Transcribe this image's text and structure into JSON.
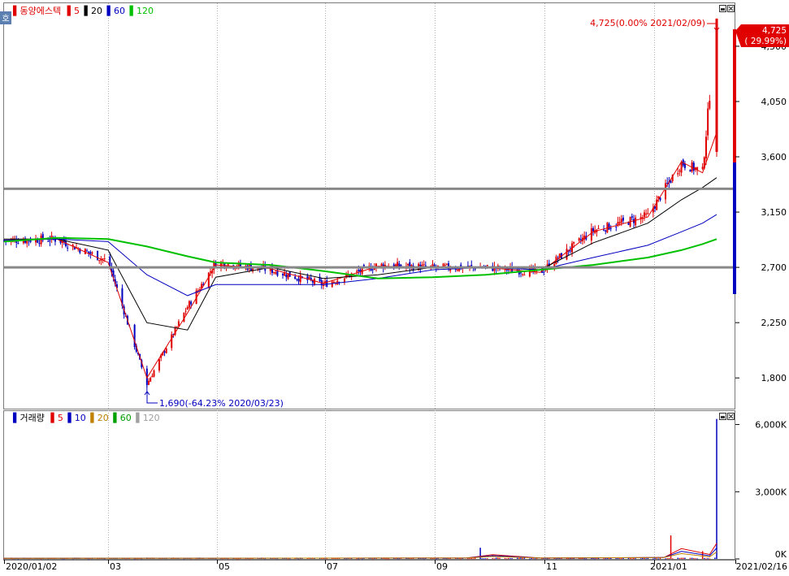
{
  "price_panel": {
    "legend_prefix": "▌",
    "name": "동양에스텍",
    "ma_labels": [
      {
        "text": "5",
        "color": "#e00000"
      },
      {
        "text": "20",
        "color": "#000000"
      },
      {
        "text": "60",
        "color": "#0000c0"
      },
      {
        "text": "120",
        "color": "#00c000"
      }
    ],
    "corner_tag": "호",
    "current_price_label": "4,725",
    "current_change_label": "( 29.99%)",
    "high_annotation": "4,725(0.00% 2021/02/09)",
    "low_annotation": "1,690(-64.23% 2020/03/23)"
  },
  "volume_panel": {
    "legend_prefix": "▌",
    "name": "거래량",
    "ma_labels": [
      {
        "text": "5",
        "color": "#e00000"
      },
      {
        "text": "10",
        "color": "#0000c0"
      },
      {
        "text": "20",
        "color": "#c08000"
      },
      {
        "text": "60",
        "color": "#00a000"
      },
      {
        "text": "120",
        "color": "#a0a0a0"
      }
    ]
  },
  "x_axis": {
    "labels": [
      "2020/01/02",
      "03",
      "05",
      "07",
      "09",
      "11",
      "2021/01",
      "2021/02/16"
    ]
  },
  "chart_data": [
    {
      "type": "candlestick",
      "title": "동양에스텍",
      "x": [
        "2020-01-02",
        "2020-02-01",
        "2020-03-01",
        "2020-03-23",
        "2020-04-15",
        "2020-05-01",
        "2020-06-01",
        "2020-07-01",
        "2020-08-01",
        "2020-09-01",
        "2020-10-01",
        "2020-11-01",
        "2020-12-01",
        "2021-01-01",
        "2021-01-20",
        "2021-02-01",
        "2021-02-09"
      ],
      "close": [
        2920,
        2930,
        2750,
        1750,
        2380,
        2740,
        2680,
        2560,
        2720,
        2700,
        2700,
        2660,
        3000,
        3120,
        3550,
        3480,
        4725
      ],
      "y_ticks": [
        1800,
        2250,
        2700,
        3150,
        3600,
        4050,
        4500
      ],
      "ylim": [
        1550,
        4850
      ],
      "high": 4725,
      "low": 1690,
      "support_lines": [
        3340,
        2700
      ],
      "series": [
        {
          "name": "5",
          "color": "#e00000",
          "values": [
            2920,
            2930,
            2740,
            1800,
            2330,
            2720,
            2690,
            2570,
            2710,
            2700,
            2700,
            2660,
            2990,
            3110,
            3560,
            3470,
            3800
          ]
        },
        {
          "name": "20",
          "color": "#000000",
          "values": [
            2930,
            2930,
            2840,
            2250,
            2190,
            2620,
            2700,
            2610,
            2640,
            2700,
            2700,
            2680,
            2900,
            3060,
            3250,
            3350,
            3430
          ]
        },
        {
          "name": "60",
          "color": "#0000c0",
          "values": [
            2920,
            2930,
            2910,
            2640,
            2470,
            2560,
            2560,
            2560,
            2610,
            2680,
            2700,
            2680,
            2780,
            2880,
            2990,
            3060,
            3130
          ]
        },
        {
          "name": "120",
          "color": "#00c000",
          "values": [
            2910,
            2940,
            2930,
            2870,
            2790,
            2740,
            2720,
            2670,
            2610,
            2620,
            2640,
            2680,
            2720,
            2780,
            2840,
            2890,
            2930
          ]
        }
      ]
    },
    {
      "type": "bar",
      "title": "거래량",
      "x": [
        "2020-01-02",
        "2020-03-23",
        "2020-06-15",
        "2020-09-01",
        "2020-09-28",
        "2020-11-01",
        "2021-01-05",
        "2021-01-14",
        "2021-02-01",
        "2021-02-09"
      ],
      "values": [
        30,
        60,
        40,
        40,
        500,
        30,
        60,
        1050,
        350,
        6250
      ],
      "unit": "K",
      "y_ticks": [
        0,
        3000,
        6000
      ],
      "y_tick_labels": [
        "0K",
        "3,000K",
        "6,000K"
      ],
      "ylim": [
        0,
        6600
      ]
    }
  ]
}
